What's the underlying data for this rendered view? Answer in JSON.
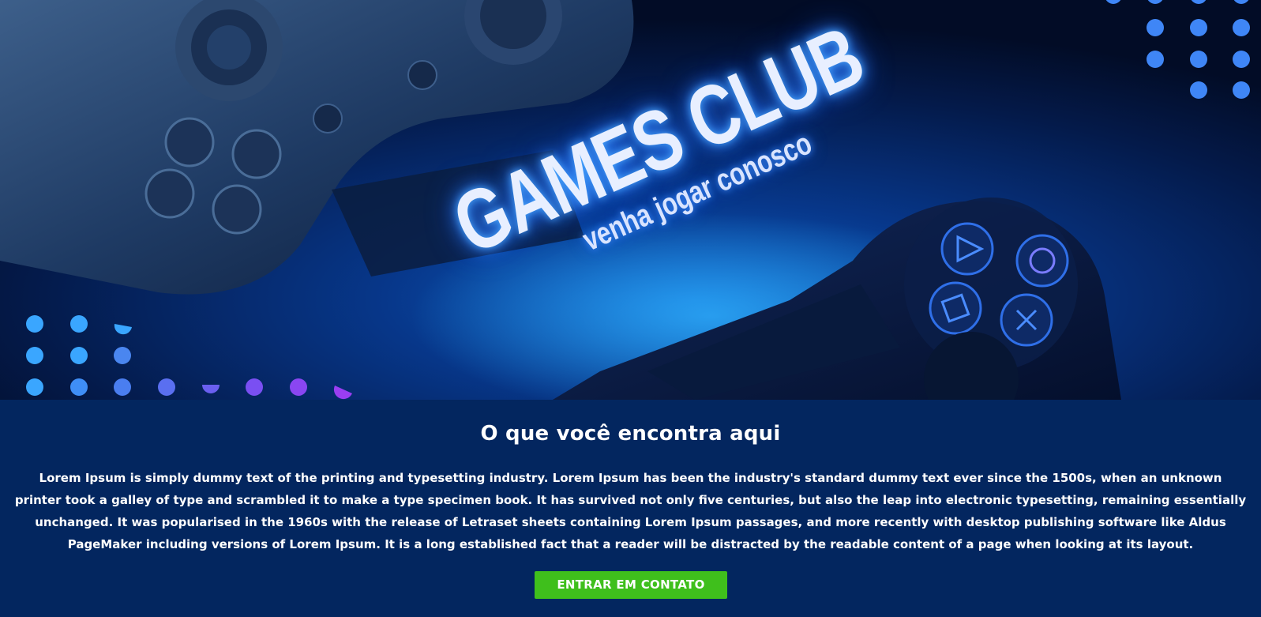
{
  "hero": {
    "title": "GAMES CLUB",
    "subtitle": "venha jogar conosco"
  },
  "content": {
    "heading": "O que você encontra aqui",
    "body": "Lorem Ipsum is simply dummy text of the printing and typesetting industry. Lorem Ipsum has been the industry's standard dummy text ever since the 1500s, when an unknown printer took a galley of type and scrambled it to make a type specimen book. It has survived not only five centuries, but also the leap into electronic typesetting, remaining essentially unchanged. It was popularised in the 1960s with the release of Letraset sheets containing Lorem Ipsum passages, and more recently with desktop publishing software like Aldus PageMaker including versions of Lorem Ipsum. It is a long established fact that a reader will be distracted by the readable content of a page when looking at its layout.",
    "cta_label": "ENTRAR EM CONTATO"
  },
  "colors": {
    "section_background": "#03265f",
    "cta_background": "#3fbf1c",
    "text": "#ffffff",
    "glow": "#4aa8ff"
  }
}
